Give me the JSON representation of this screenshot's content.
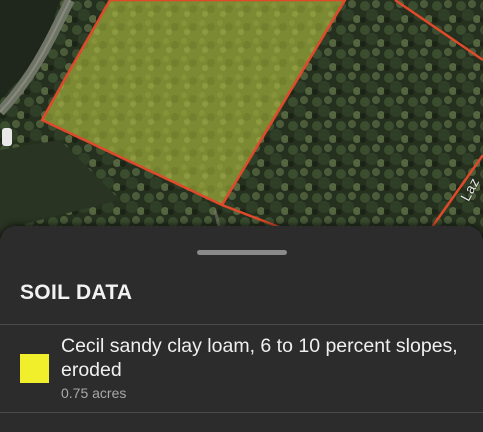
{
  "map": {
    "road_label": "Laz",
    "parcel_fill_color": "#8e9a2a",
    "boundary_color": "#e04a2a"
  },
  "sheet": {
    "title": "SOIL DATA",
    "soils": [
      {
        "name": "Cecil sandy clay loam, 6 to 10 percent slopes, eroded",
        "acres": "0.75 acres",
        "color": "#f1ee2c"
      }
    ]
  }
}
